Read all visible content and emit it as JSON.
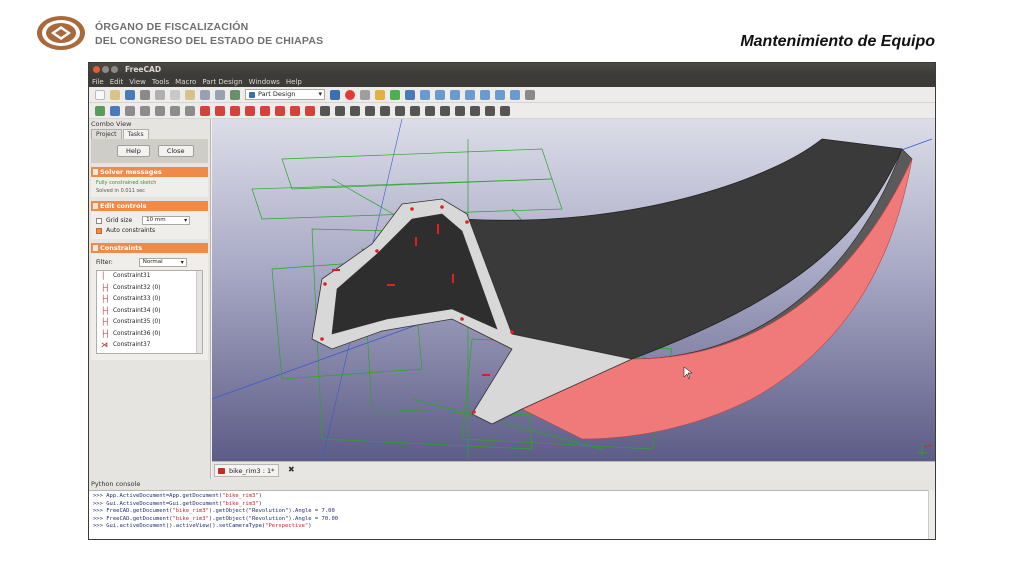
{
  "slide": {
    "org_line1": "ÓRGANO DE FISCALIZACIÓN",
    "org_line2": "DEL CONGRESO DEL ESTADO DE CHIAPAS",
    "title": "Mantenimiento de Equipo"
  },
  "window": {
    "title": "FreeCAD",
    "menu": [
      "File",
      "Edit",
      "View",
      "Tools",
      "Macro",
      "Part Design",
      "Windows",
      "Help"
    ],
    "workbench": "Part Design"
  },
  "combo": {
    "title": "Combo View",
    "tabs": [
      "Project",
      "Tasks"
    ],
    "help_label": "Help",
    "close_label": "Close",
    "solver": {
      "header": "Solver messages",
      "line1": "Fully constrained sketch",
      "line2": "Solved in 0.011 sec"
    },
    "edit": {
      "header": "Edit controls",
      "grid_label": "Grid size",
      "grid_value": "10 mm",
      "auto_label": "Auto constraints"
    },
    "constraints": {
      "header": "Constraints",
      "filter_label": "Filter:",
      "filter_value": "Normal",
      "items": [
        {
          "icon": "│",
          "label": "Constraint31"
        },
        {
          "icon": "├┤",
          "label": "Constraint32 (0)"
        },
        {
          "icon": "├┤",
          "label": "Constraint33 (0)"
        },
        {
          "icon": "├┤",
          "label": "Constraint34 (0)"
        },
        {
          "icon": "├┤",
          "label": "Constraint35 (0)"
        },
        {
          "icon": "├┤",
          "label": "Constraint36 (0)"
        },
        {
          "icon": "⋊",
          "label": "Constraint37"
        }
      ]
    }
  },
  "doc_tab": "bike_rim3 : 1*",
  "console": {
    "title": "Python console",
    "lines": [
      {
        "pre": ">>> App.ActiveDocument=App.getDocument(",
        "str": "\"bike_rim3\"",
        "post": ")"
      },
      {
        "pre": ">>> Gui.ActiveDocument=Gui.getDocument(",
        "str": "\"bike_rim3\"",
        "post": ")"
      },
      {
        "pre": ">>> FreeCAD.getDocument(",
        "str": "\"bike_rim3\"",
        "post": ").getObject(\"Revolution\").Angle = 7.00"
      },
      {
        "pre": ">>> FreeCAD.getDocument(",
        "str": "\"bike_rim3\"",
        "post": ").getObject(\"Revolution\").Angle = 70.00"
      },
      {
        "pre": ">>> Gui.activeDocument().activeView().setCameraType(",
        "str": "\"Perspective\"",
        "post": ")"
      }
    ]
  },
  "colors": {
    "logo": "#a86a3c",
    "section_header": "#f08a48",
    "rim_top": "#3a3a3a",
    "rim_face": "#f07a7a",
    "sketch": "#2aa52a",
    "constraint": "#e02020"
  }
}
